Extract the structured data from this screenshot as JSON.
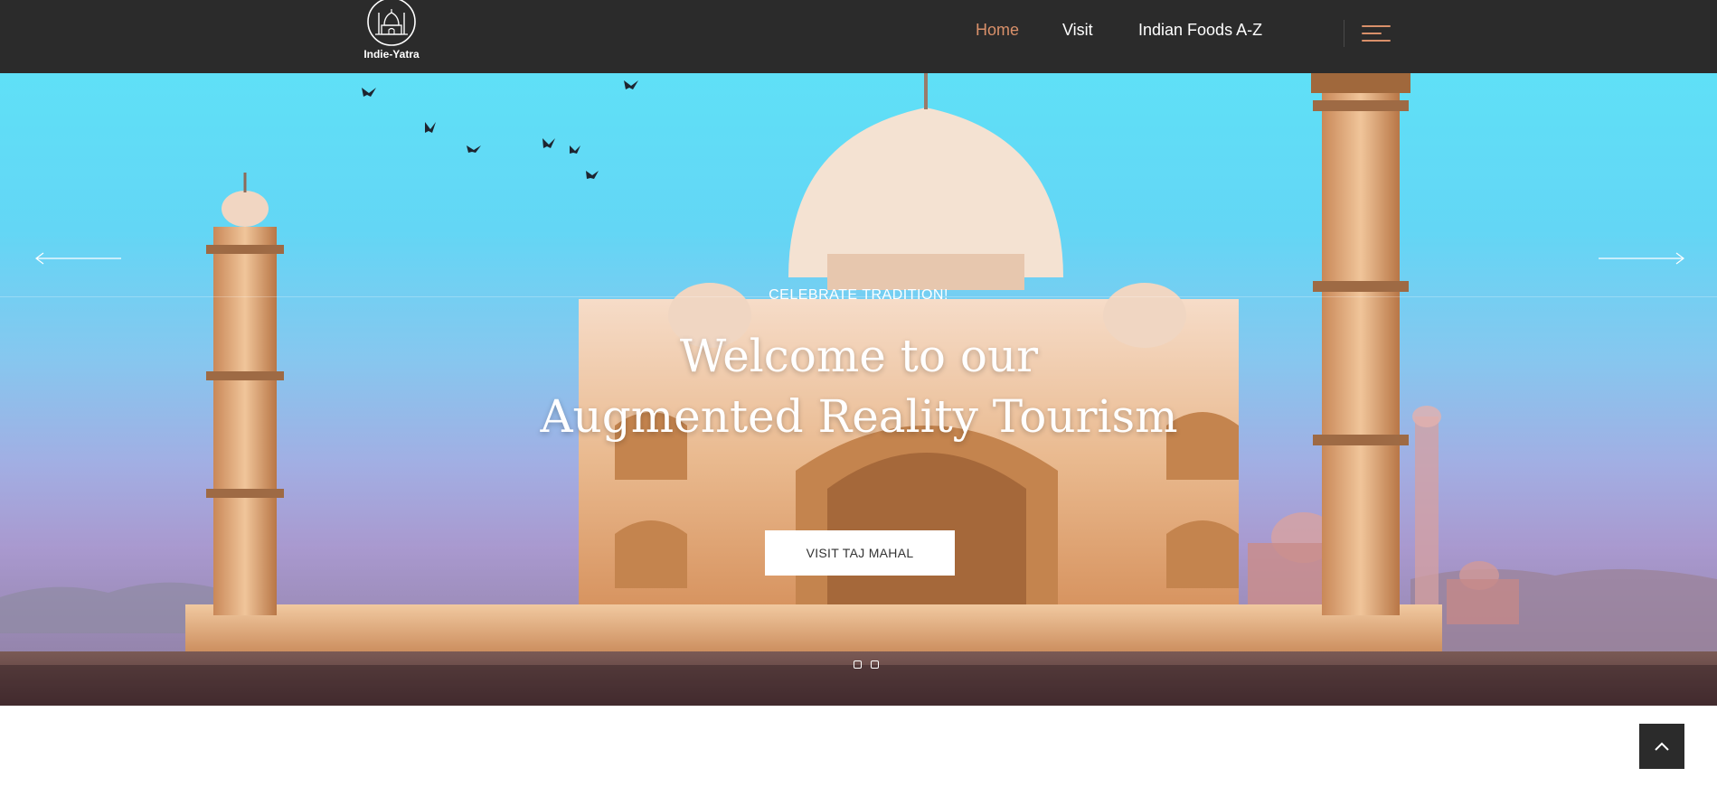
{
  "brand": {
    "name": "Indie-Yatra",
    "logo_icon": "mosque-icon"
  },
  "nav": {
    "items": [
      {
        "label": "Home",
        "active": true
      },
      {
        "label": "Visit",
        "active": false
      },
      {
        "label": "Indian Foods A-Z",
        "active": false
      }
    ],
    "menu_icon": "hamburger-icon"
  },
  "hero": {
    "kicker": "CELEBRATE TRADITION!",
    "title_line1": "Welcome to our",
    "title_line2": "Augmented Reality Tourism",
    "cta_label": "VISIT TAJ MAHAL",
    "slides_total": 2,
    "prev_icon": "arrow-left-icon",
    "next_icon": "arrow-right-icon"
  },
  "scroll_top_icon": "chevron-up-icon",
  "colors": {
    "topbar": "#2b2b2b",
    "accent": "#d9906a",
    "white": "#ffffff"
  }
}
